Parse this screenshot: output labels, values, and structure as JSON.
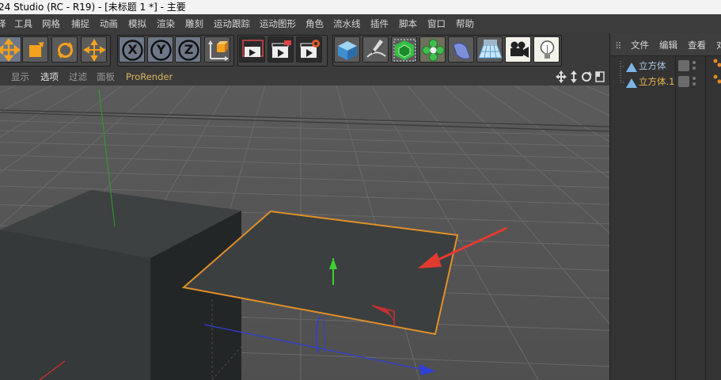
{
  "window": {
    "title": "24 Studio (RC - R19) - [未标题 1 *] - 主要"
  },
  "menu": {
    "items": [
      "译",
      "工具",
      "网格",
      "捕捉",
      "动画",
      "模拟",
      "渲染",
      "雕刻",
      "运动跟踪",
      "运动图形",
      "角色",
      "流水线",
      "插件",
      "脚本",
      "窗口",
      "帮助"
    ]
  },
  "toolbar": {
    "move_tool": "move-icon",
    "scale_tool": "scale-icon",
    "rotate_tool": "rotate-icon",
    "last_tool": "move-icon",
    "axis_x": "X",
    "axis_y": "Y",
    "axis_z": "Z",
    "coord_system": "world-coordinate-icon",
    "render_view": "render-view-icon",
    "render_picture": "render-picture-icon",
    "render_settings": "render-settings-icon",
    "cube": "cube-icon",
    "pen": "pen-spline-icon",
    "subdivision": "subdivision-icon",
    "cloner": "cloner-icon",
    "deformer": "deformer-icon",
    "floor": "floor-icon",
    "camera": "camera-icon",
    "light": "light-icon"
  },
  "viewport_menu": {
    "items": [
      "显示",
      "选项",
      "过滤",
      "面板",
      "ProRender"
    ],
    "active": "选项"
  },
  "object_manager": {
    "tabs": [
      "文件",
      "编辑",
      "查看",
      "对"
    ],
    "objects": [
      {
        "name": "立方体",
        "selected": false
      },
      {
        "name": "立方体.1",
        "selected": true
      }
    ]
  },
  "colors": {
    "selection_outline": "#e0902a",
    "annotation_arrow": "#e23b30",
    "axis_y": "#3ccf2f",
    "axis_x": "#d23030",
    "axis_z": "#2f3fd8",
    "selected_object_text": "#e9b64a"
  }
}
